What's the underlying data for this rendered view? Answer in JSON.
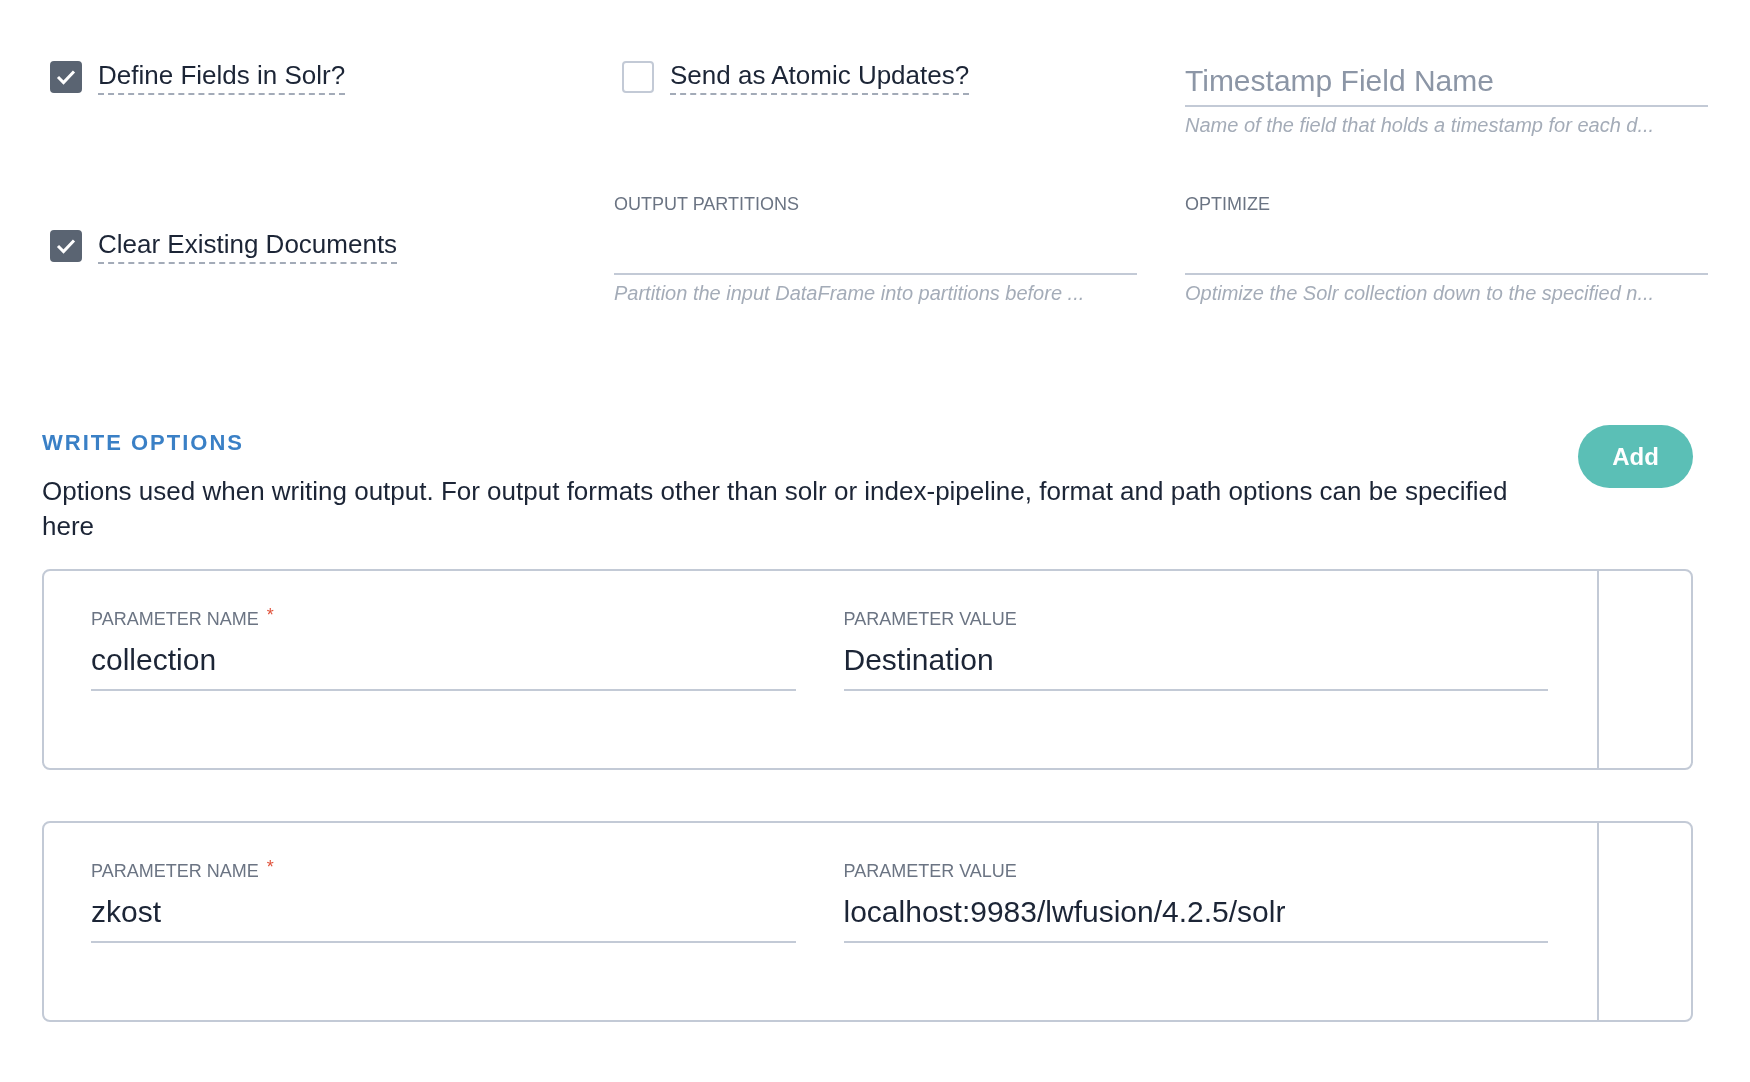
{
  "settings": [
    {
      "kind": "checkbox",
      "label": "Define Fields in Solr?",
      "checked": true
    },
    {
      "kind": "checkbox",
      "label": "Send as Atomic Updates?",
      "checked": false
    },
    {
      "kind": "input",
      "placeholder": "Timestamp Field Name",
      "help": "Name of the field that holds a timestamp for each d..."
    },
    {
      "kind": "checkbox",
      "label": "Clear Existing Documents",
      "checked": true
    },
    {
      "kind": "input",
      "label": "OUTPUT PARTITIONS",
      "help": "Partition the input DataFrame into partitions before ..."
    },
    {
      "kind": "input",
      "label": "OPTIMIZE",
      "help": "Optimize the Solr collection down to the specified n..."
    }
  ],
  "write_options": {
    "title": "WRITE OPTIONS",
    "description": "Options used when writing output. For output formats other than solr or index-pipeline, format and path options can be specified here",
    "add_button": "Add",
    "params": [
      {
        "name_label": "PARAMETER NAME",
        "required_mark": "*",
        "name": "collection",
        "value_label": "PARAMETER VALUE",
        "value": "Destination"
      },
      {
        "name_label": "PARAMETER NAME",
        "required_mark": "*",
        "name": "zkost",
        "value_label": "PARAMETER VALUE",
        "value": "localhost:9983/lwfusion/4.2.5/solr"
      }
    ]
  }
}
